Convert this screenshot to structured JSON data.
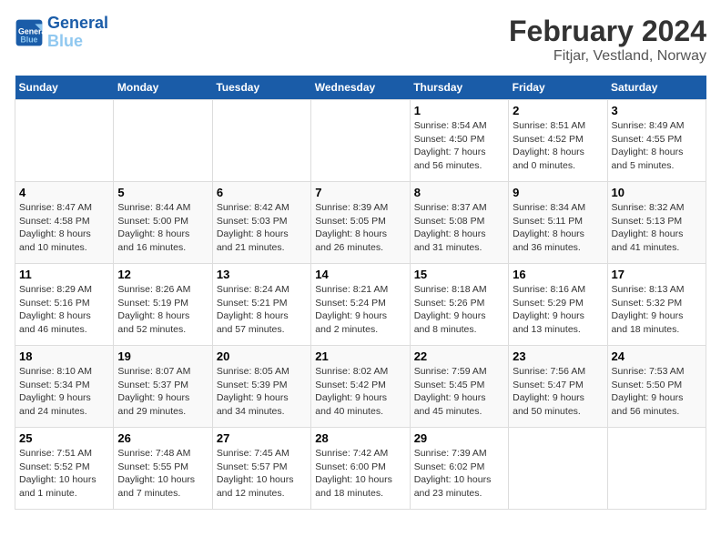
{
  "logo": {
    "line1": "General",
    "line2": "Blue"
  },
  "title": "February 2024",
  "subtitle": "Fitjar, Vestland, Norway",
  "days_of_week": [
    "Sunday",
    "Monday",
    "Tuesday",
    "Wednesday",
    "Thursday",
    "Friday",
    "Saturday"
  ],
  "weeks": [
    [
      {
        "day": "",
        "info": ""
      },
      {
        "day": "",
        "info": ""
      },
      {
        "day": "",
        "info": ""
      },
      {
        "day": "",
        "info": ""
      },
      {
        "day": "1",
        "info": "Sunrise: 8:54 AM\nSunset: 4:50 PM\nDaylight: 7 hours\nand 56 minutes."
      },
      {
        "day": "2",
        "info": "Sunrise: 8:51 AM\nSunset: 4:52 PM\nDaylight: 8 hours\nand 0 minutes."
      },
      {
        "day": "3",
        "info": "Sunrise: 8:49 AM\nSunset: 4:55 PM\nDaylight: 8 hours\nand 5 minutes."
      }
    ],
    [
      {
        "day": "4",
        "info": "Sunrise: 8:47 AM\nSunset: 4:58 PM\nDaylight: 8 hours\nand 10 minutes."
      },
      {
        "day": "5",
        "info": "Sunrise: 8:44 AM\nSunset: 5:00 PM\nDaylight: 8 hours\nand 16 minutes."
      },
      {
        "day": "6",
        "info": "Sunrise: 8:42 AM\nSunset: 5:03 PM\nDaylight: 8 hours\nand 21 minutes."
      },
      {
        "day": "7",
        "info": "Sunrise: 8:39 AM\nSunset: 5:05 PM\nDaylight: 8 hours\nand 26 minutes."
      },
      {
        "day": "8",
        "info": "Sunrise: 8:37 AM\nSunset: 5:08 PM\nDaylight: 8 hours\nand 31 minutes."
      },
      {
        "day": "9",
        "info": "Sunrise: 8:34 AM\nSunset: 5:11 PM\nDaylight: 8 hours\nand 36 minutes."
      },
      {
        "day": "10",
        "info": "Sunrise: 8:32 AM\nSunset: 5:13 PM\nDaylight: 8 hours\nand 41 minutes."
      }
    ],
    [
      {
        "day": "11",
        "info": "Sunrise: 8:29 AM\nSunset: 5:16 PM\nDaylight: 8 hours\nand 46 minutes."
      },
      {
        "day": "12",
        "info": "Sunrise: 8:26 AM\nSunset: 5:19 PM\nDaylight: 8 hours\nand 52 minutes."
      },
      {
        "day": "13",
        "info": "Sunrise: 8:24 AM\nSunset: 5:21 PM\nDaylight: 8 hours\nand 57 minutes."
      },
      {
        "day": "14",
        "info": "Sunrise: 8:21 AM\nSunset: 5:24 PM\nDaylight: 9 hours\nand 2 minutes."
      },
      {
        "day": "15",
        "info": "Sunrise: 8:18 AM\nSunset: 5:26 PM\nDaylight: 9 hours\nand 8 minutes."
      },
      {
        "day": "16",
        "info": "Sunrise: 8:16 AM\nSunset: 5:29 PM\nDaylight: 9 hours\nand 13 minutes."
      },
      {
        "day": "17",
        "info": "Sunrise: 8:13 AM\nSunset: 5:32 PM\nDaylight: 9 hours\nand 18 minutes."
      }
    ],
    [
      {
        "day": "18",
        "info": "Sunrise: 8:10 AM\nSunset: 5:34 PM\nDaylight: 9 hours\nand 24 minutes."
      },
      {
        "day": "19",
        "info": "Sunrise: 8:07 AM\nSunset: 5:37 PM\nDaylight: 9 hours\nand 29 minutes."
      },
      {
        "day": "20",
        "info": "Sunrise: 8:05 AM\nSunset: 5:39 PM\nDaylight: 9 hours\nand 34 minutes."
      },
      {
        "day": "21",
        "info": "Sunrise: 8:02 AM\nSunset: 5:42 PM\nDaylight: 9 hours\nand 40 minutes."
      },
      {
        "day": "22",
        "info": "Sunrise: 7:59 AM\nSunset: 5:45 PM\nDaylight: 9 hours\nand 45 minutes."
      },
      {
        "day": "23",
        "info": "Sunrise: 7:56 AM\nSunset: 5:47 PM\nDaylight: 9 hours\nand 50 minutes."
      },
      {
        "day": "24",
        "info": "Sunrise: 7:53 AM\nSunset: 5:50 PM\nDaylight: 9 hours\nand 56 minutes."
      }
    ],
    [
      {
        "day": "25",
        "info": "Sunrise: 7:51 AM\nSunset: 5:52 PM\nDaylight: 10 hours\nand 1 minute."
      },
      {
        "day": "26",
        "info": "Sunrise: 7:48 AM\nSunset: 5:55 PM\nDaylight: 10 hours\nand 7 minutes."
      },
      {
        "day": "27",
        "info": "Sunrise: 7:45 AM\nSunset: 5:57 PM\nDaylight: 10 hours\nand 12 minutes."
      },
      {
        "day": "28",
        "info": "Sunrise: 7:42 AM\nSunset: 6:00 PM\nDaylight: 10 hours\nand 18 minutes."
      },
      {
        "day": "29",
        "info": "Sunrise: 7:39 AM\nSunset: 6:02 PM\nDaylight: 10 hours\nand 23 minutes."
      },
      {
        "day": "",
        "info": ""
      },
      {
        "day": "",
        "info": ""
      }
    ]
  ]
}
